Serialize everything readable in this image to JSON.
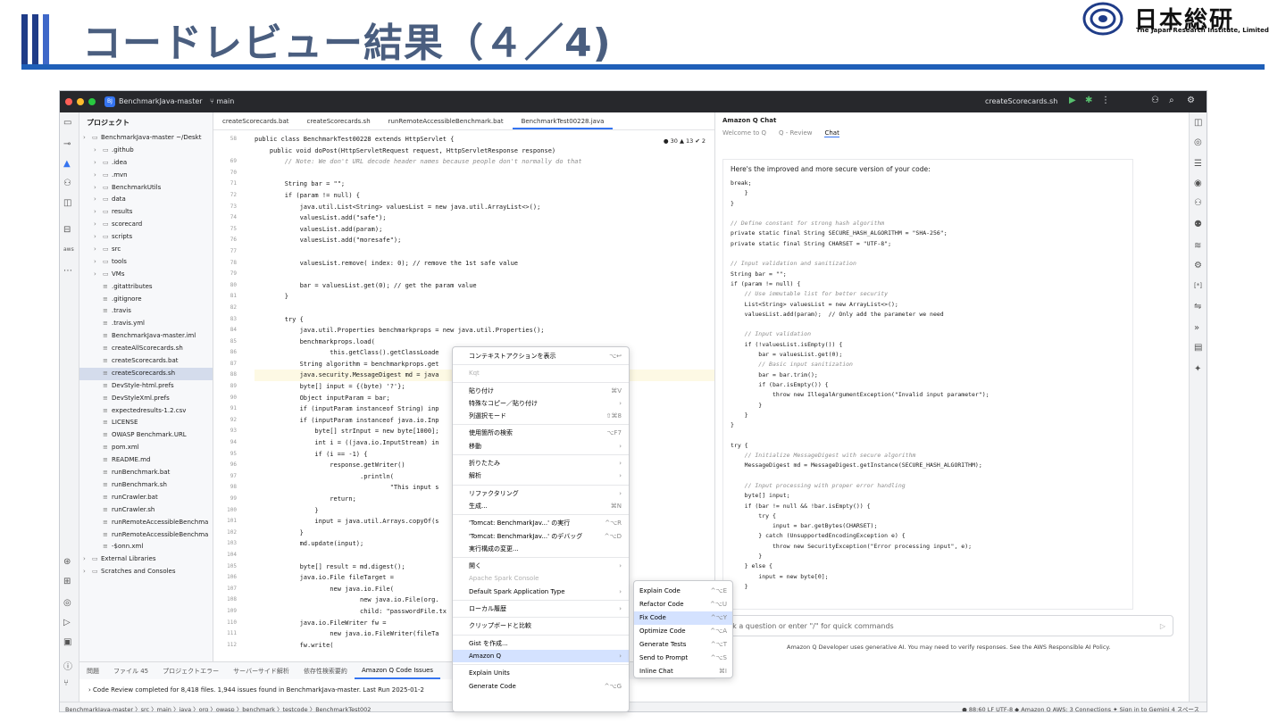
{
  "slide": {
    "title": "コードレビュー結果（４／4)",
    "logo_name": "日本総研",
    "logo_sub": "The Japan Research Institute, Limited"
  },
  "ide": {
    "project_name": "BenchmarkJava-master",
    "branch": "main",
    "run_config": "createScorecards.sh",
    "tree_header": "プロジェクト",
    "tree": [
      {
        "label": "BenchmarkJava-master ~/Deskt",
        "icon": "folder-icon",
        "indent": 0
      },
      {
        "label": ".github",
        "icon": "folder-icon",
        "indent": 1
      },
      {
        "label": ".idea",
        "icon": "folder-icon",
        "indent": 1
      },
      {
        "label": ".mvn",
        "icon": "folder-icon",
        "indent": 1
      },
      {
        "label": "BenchmarkUtils",
        "icon": "folder-icon",
        "indent": 1
      },
      {
        "label": "data",
        "icon": "folder-icon",
        "indent": 1
      },
      {
        "label": "results",
        "icon": "folder-icon",
        "indent": 1
      },
      {
        "label": "scorecard",
        "icon": "folder-icon",
        "indent": 1
      },
      {
        "label": "scripts",
        "icon": "folder-icon",
        "indent": 1
      },
      {
        "label": "src",
        "icon": "folder-icon",
        "indent": 1
      },
      {
        "label": "tools",
        "icon": "folder-icon",
        "indent": 1
      },
      {
        "label": "VMs",
        "icon": "folder-icon",
        "indent": 1
      },
      {
        "label": ".gitattributes",
        "icon": "file-icon",
        "indent": 1
      },
      {
        "label": ".gitignore",
        "icon": "file-icon",
        "indent": 1
      },
      {
        "label": ".travis",
        "icon": "file-icon",
        "indent": 1
      },
      {
        "label": ".travis.yml",
        "icon": "file-icon",
        "indent": 1
      },
      {
        "label": "BenchmarkJava-master.iml",
        "icon": "file-icon",
        "indent": 1
      },
      {
        "label": "createAllScorecards.sh",
        "icon": "file-icon",
        "indent": 1
      },
      {
        "label": "createScorecards.bat",
        "icon": "file-icon",
        "indent": 1
      },
      {
        "label": "createScorecards.sh",
        "icon": "file-icon",
        "indent": 1,
        "selected": true
      },
      {
        "label": "DevStyle-html.prefs",
        "icon": "file-icon",
        "indent": 1
      },
      {
        "label": "DevStyleXml.prefs",
        "icon": "file-icon",
        "indent": 1
      },
      {
        "label": "expectedresults-1.2.csv",
        "icon": "file-icon",
        "indent": 1
      },
      {
        "label": "LICENSE",
        "icon": "file-icon",
        "indent": 1
      },
      {
        "label": "OWASP Benchmark.URL",
        "icon": "file-icon",
        "indent": 1
      },
      {
        "label": "pom.xml",
        "icon": "file-icon",
        "indent": 1
      },
      {
        "label": "README.md",
        "icon": "file-icon",
        "indent": 1
      },
      {
        "label": "runBenchmark.bat",
        "icon": "file-icon",
        "indent": 1
      },
      {
        "label": "runBenchmark.sh",
        "icon": "file-icon",
        "indent": 1
      },
      {
        "label": "runCrawler.bat",
        "icon": "file-icon",
        "indent": 1
      },
      {
        "label": "runCrawler.sh",
        "icon": "file-icon",
        "indent": 1
      },
      {
        "label": "runRemoteAccessibleBenchma",
        "icon": "file-icon",
        "indent": 1
      },
      {
        "label": "runRemoteAccessibleBenchma",
        "icon": "file-icon",
        "indent": 1
      },
      {
        "label": "-$onn.xml",
        "icon": "file-icon",
        "indent": 1
      },
      {
        "label": "External Libraries",
        "icon": "folder-icon",
        "indent": 0
      },
      {
        "label": "Scratches and Consoles",
        "icon": "folder-icon",
        "indent": 0
      }
    ],
    "editor_tabs": [
      {
        "label": "createScorecards.bat",
        "active": false
      },
      {
        "label": "createScorecards.sh",
        "active": false
      },
      {
        "label": "runRemoteAccessibleBenchmark.bat",
        "active": false
      },
      {
        "label": "BenchmarkTest00228.java",
        "active": true
      }
    ],
    "inspections": "● 30  ▲ 13  ✔ 2",
    "code": [
      {
        "n": "58",
        "t": "public class BenchmarkTest00228 extends HttpServlet {"
      },
      {
        "n": "",
        "t": "    public void doPost(HttpServletRequest request, HttpServletResponse response)"
      },
      {
        "n": "69",
        "t": "        // Note: We don't URL decode header names because people don't normally do that"
      },
      {
        "n": "70",
        "t": ""
      },
      {
        "n": "71",
        "t": "        String bar = \"\";"
      },
      {
        "n": "72",
        "t": "        if (param != null) {"
      },
      {
        "n": "73",
        "t": "            java.util.List<String> valuesList = new java.util.ArrayList<>();"
      },
      {
        "n": "74",
        "t": "            valuesList.add(\"safe\");"
      },
      {
        "n": "75",
        "t": "            valuesList.add(param);"
      },
      {
        "n": "76",
        "t": "            valuesList.add(\"moresafe\");"
      },
      {
        "n": "77",
        "t": ""
      },
      {
        "n": "78",
        "t": "            valuesList.remove( index: 0); // remove the 1st safe value"
      },
      {
        "n": "79",
        "t": ""
      },
      {
        "n": "80",
        "t": "            bar = valuesList.get(0); // get the param value"
      },
      {
        "n": "81",
        "t": "        }"
      },
      {
        "n": "82",
        "t": ""
      },
      {
        "n": "83",
        "t": "        try {"
      },
      {
        "n": "84",
        "t": "            java.util.Properties benchmarkprops = new java.util.Properties();"
      },
      {
        "n": "85",
        "t": "            benchmarkprops.load("
      },
      {
        "n": "86",
        "t": "                    this.getClass().getClassLoade                                   perties\"));"
      },
      {
        "n": "87",
        "t": "            String algorithm = benchmarkprops.get"
      },
      {
        "n": "88",
        "t": "            java.security.MessageDigest md = java                                  );"
      },
      {
        "n": "89",
        "t": "            byte[] input = {(byte) '?'};"
      },
      {
        "n": "90",
        "t": "            Object inputParam = bar;"
      },
      {
        "n": "91",
        "t": "            if (inputParam instanceof String) inp"
      },
      {
        "n": "92",
        "t": "            if (inputParam instanceof java.io.Inp"
      },
      {
        "n": "93",
        "t": "                byte[] strInput = new byte[1000];"
      },
      {
        "n": "94",
        "t": "                int i = ((java.io.InputStream) in"
      },
      {
        "n": "95",
        "t": "                if (i == -1) {"
      },
      {
        "n": "96",
        "t": "                    response.getWriter()"
      },
      {
        "n": "97",
        "t": "                            .println("
      },
      {
        "n": "98",
        "t": "                                    \"This input s                    e UI for the InputSt"
      },
      {
        "n": "99",
        "t": "                    return;"
      },
      {
        "n": "100",
        "t": "                }"
      },
      {
        "n": "101",
        "t": "                input = java.util.Arrays.copyOf(s"
      },
      {
        "n": "102",
        "t": "            }"
      },
      {
        "n": "103",
        "t": "            md.update(input);"
      },
      {
        "n": "104",
        "t": ""
      },
      {
        "n": "105",
        "t": "            byte[] result = md.digest();"
      },
      {
        "n": "106",
        "t": "            java.io.File fileTarget ="
      },
      {
        "n": "107",
        "t": "                    new java.io.File("
      },
      {
        "n": "108",
        "t": "                            new java.io.File(org."
      },
      {
        "n": "109",
        "t": "                            child: \"passwordFile.tx"
      },
      {
        "n": "110",
        "t": "            java.io.FileWriter fw ="
      },
      {
        "n": "111",
        "t": "                    new java.io.FileWriter(fileTa"
      },
      {
        "n": "112",
        "t": "            fw.write("
      }
    ],
    "q_title": "Amazon Q Chat",
    "q_tabs": [
      "Welcome to Q",
      "Q - Review",
      "Chat"
    ],
    "q_intro": "Here's the improved and more secure version of your code:",
    "q_code": [
      "break;",
      "    }",
      "}",
      "",
      "// Define constant for strong hash algorithm",
      "private static final String SECURE_HASH_ALGORITHM = \"SHA-256\";",
      "private static final String CHARSET = \"UTF-8\";",
      "",
      "// Input validation and sanitization",
      "String bar = \"\";",
      "if (param != null) {",
      "    // Use immutable list for better security",
      "    List<String> valuesList = new ArrayList<>();",
      "    valuesList.add(param);  // Only add the parameter we need",
      "",
      "    // Input validation",
      "    if (!valuesList.isEmpty()) {",
      "        bar = valuesList.get(0);",
      "        // Basic input sanitization",
      "        bar = bar.trim();",
      "        if (bar.isEmpty()) {",
      "            throw new IllegalArgumentException(\"Invalid input parameter\");",
      "        }",
      "    }",
      "}",
      "",
      "try {",
      "    // Initialize MessageDigest with secure algorithm",
      "    MessageDigest md = MessageDigest.getInstance(SECURE_HASH_ALGORITHM);",
      "",
      "    // Input processing with proper error handling",
      "    byte[] input;",
      "    if (bar != null && !bar.isEmpty()) {",
      "        try {",
      "            input = bar.getBytes(CHARSET);",
      "        } catch (UnsupportedEncodingException e) {",
      "            throw new SecurityException(\"Error processing input\", e);",
      "        }",
      "    } else {",
      "        input = new byte[0];",
      "    }"
    ],
    "q_input_placeholder": "sk a question or enter \"/\" for quick commands",
    "q_disclaimer": "Amazon Q Developer uses generative AI. You may need to verify responses. See the AWS Responsible AI Policy.",
    "bottom_tabs": [
      "問題",
      "ファイル 45",
      "プロジェクトエラー",
      "サーバーサイド解析",
      "依存性検索要約",
      "Amazon Q Code Issues"
    ],
    "problem_row": "Code Review completed for 8,418 files. 1,944 issues found in BenchmarkJava-master. Last Run 2025-01-2",
    "status_path": "BenchmarkJava-master 〉src 〉main 〉java 〉org 〉owasp 〉benchmark 〉testcode 〉BenchmarkTest002",
    "status_right": "● 88:60   LF   UTF-8   ◆ Amazon Q   AWS: 3 Connections   ✦ Sign in to Gemini   4 スペース",
    "context_menu": [
      {
        "label": "コンテキストアクションを表示",
        "sc": "⌥↩",
        "type": "item"
      },
      {
        "type": "sep"
      },
      {
        "label": "Kqt",
        "sc": "",
        "type": "dis"
      },
      {
        "type": "sep"
      },
      {
        "label": "貼り付け",
        "sc": "⌘V",
        "type": "item"
      },
      {
        "label": "特殊なコピー／貼り付け",
        "sc": "›",
        "type": "item"
      },
      {
        "label": "列選択モード",
        "sc": "⇧⌘8",
        "type": "item"
      },
      {
        "type": "sep"
      },
      {
        "label": "使用箇所の検索",
        "sc": "⌥F7",
        "type": "item"
      },
      {
        "label": "移動",
        "sc": "›",
        "type": "item"
      },
      {
        "type": "sep"
      },
      {
        "label": "折りたたみ",
        "sc": "›",
        "type": "item"
      },
      {
        "label": "解析",
        "sc": "›",
        "type": "item"
      },
      {
        "type": "sep"
      },
      {
        "label": "リファクタリング",
        "sc": "›",
        "type": "item"
      },
      {
        "label": "生成...",
        "sc": "⌘N",
        "type": "item"
      },
      {
        "type": "sep"
      },
      {
        "label": "'Tomcat: BenchmarkJav...' の実行",
        "sc": "^⌥R",
        "type": "item"
      },
      {
        "label": "'Tomcat: BenchmarkJav...' のデバッグ",
        "sc": "^⌥D",
        "type": "item"
      },
      {
        "label": "実行構成の変更...",
        "sc": "",
        "type": "item"
      },
      {
        "type": "sep"
      },
      {
        "label": "開く",
        "sc": "›",
        "type": "item"
      },
      {
        "label": "Apache Spark Console",
        "sc": "",
        "type": "dis"
      },
      {
        "label": "Default Spark Application Type",
        "sc": "›",
        "type": "item"
      },
      {
        "type": "sep"
      },
      {
        "label": "ローカル履歴",
        "sc": "›",
        "type": "item"
      },
      {
        "type": "sep"
      },
      {
        "label": "クリップボードと比較",
        "sc": "",
        "type": "item"
      },
      {
        "type": "sep"
      },
      {
        "label": "Gist を作成...",
        "sc": "",
        "type": "item"
      },
      {
        "label": "Amazon Q",
        "sc": "›",
        "type": "hl"
      },
      {
        "type": "sep"
      },
      {
        "label": "Explain Units",
        "sc": "",
        "type": "item"
      },
      {
        "label": "Generate Code",
        "sc": "^⌥G",
        "type": "item"
      }
    ],
    "submenu": [
      {
        "label": "Explain Code",
        "sc": "^⌥E",
        "hl": false
      },
      {
        "label": "Refactor Code",
        "sc": "^⌥U",
        "hl": false
      },
      {
        "label": "Fix Code",
        "sc": "^⌥Y",
        "hl": true
      },
      {
        "label": "Optimize Code",
        "sc": "^⌥A",
        "hl": false
      },
      {
        "label": "Generate Tests",
        "sc": "^⌥T",
        "hl": false
      },
      {
        "label": "Send to Prompt",
        "sc": "^⌥S",
        "hl": false
      },
      {
        "label": "Inline Chat",
        "sc": "⌘I",
        "hl": false
      }
    ]
  }
}
